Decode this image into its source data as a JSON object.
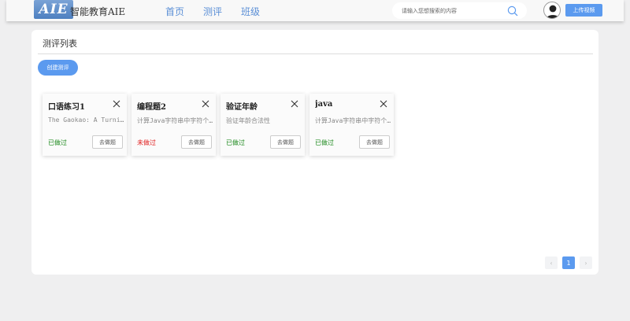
{
  "header": {
    "logo_badge": "AIE",
    "logo_text": "智能教育AIE",
    "nav": [
      "首页",
      "测评",
      "班级"
    ],
    "search_placeholder": "请输入您想搜索的内容",
    "upload_label": "上传视频"
  },
  "main": {
    "title": "测评列表",
    "create_label": "创建测评",
    "cards": [
      {
        "title": "口语练习1",
        "desc": "The Gaokao: A Turning Point",
        "status": "已做过",
        "status_color": "#1e8a1e",
        "action": "去做题"
      },
      {
        "title": "编程题2",
        "desc": "计算Java字符串中字符个数",
        "status": "未做过",
        "status_color": "#e02020",
        "action": "去做题"
      },
      {
        "title": "验证年龄",
        "desc": "验证年龄合法性",
        "status": "已做过",
        "status_color": "#1e8a1e",
        "action": "去做题"
      },
      {
        "title": "java",
        "desc": "计算Java字符串中字符个数",
        "status": "已做过",
        "status_color": "#1e8a1e",
        "action": "去做题"
      }
    ]
  },
  "pagination": {
    "prev": "‹",
    "current": "1",
    "next": "›"
  },
  "colors": {
    "accent": "#5b9aef",
    "done": "#1e8a1e",
    "not_done": "#e02020"
  },
  "icons": {
    "search": "search-icon",
    "avatar": "user-avatar-icon",
    "close": "close-icon"
  }
}
